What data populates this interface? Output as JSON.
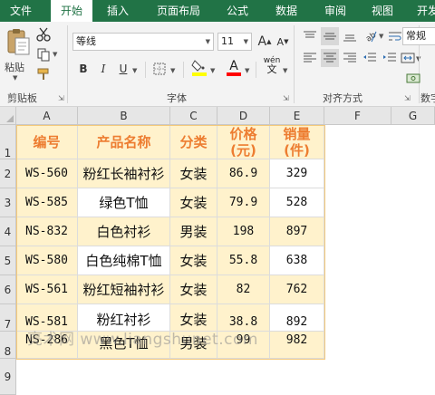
{
  "ribbon_tabs": [
    "文件",
    "开始",
    "插入",
    "页面布局",
    "公式",
    "数据",
    "审阅",
    "视图",
    "开发"
  ],
  "active_tab": "开始",
  "clipboard": {
    "paste_label": "粘贴",
    "group_label": "剪贴板"
  },
  "font": {
    "name": "等线",
    "size": "11",
    "group_label": "字体",
    "bold": "B",
    "italic": "I",
    "underline": "U",
    "grow": "A",
    "shrink": "A",
    "phonetic": "wén",
    "font_color_letter": "A"
  },
  "alignment": {
    "group_label": "对齐方式"
  },
  "number": {
    "format": "常规",
    "group_label": "数字"
  },
  "colors": {
    "ribbon_green": "#217346",
    "header_orange": "#ed7d31",
    "fill_yellow": "#fff2cc",
    "font_color_red": "#ff0000",
    "highlight_yellow": "#ffff00"
  },
  "sheet": {
    "column_headers": [
      "A",
      "B",
      "C",
      "D",
      "E",
      "F",
      "G"
    ],
    "row_headers": [
      "1",
      "2",
      "3",
      "4",
      "5",
      "6",
      "7",
      "8",
      "9"
    ],
    "header_row": [
      "编号",
      "产品名称",
      "分类",
      "价格\n(元)",
      "销量\n(件)"
    ],
    "rows": [
      [
        "WS-560",
        "粉红长袖衬衫",
        "女装",
        "86.9",
        "329"
      ],
      [
        "WS-585",
        "绿色T恤",
        "女装",
        "79.9",
        "528"
      ],
      [
        "NS-832",
        "白色衬衫",
        "男装",
        "198",
        "897"
      ],
      [
        "WS-580",
        "白色纯棉T恤",
        "女装",
        "55.8",
        "638"
      ],
      [
        "WS-561",
        "粉红短袖衬衫",
        "女装",
        "82",
        "762"
      ],
      [
        "WS-581",
        "粉红衬衫",
        "女装",
        "38.8",
        "892"
      ],
      [
        "NS-286",
        "黑色T恤",
        "男装",
        "99",
        "982"
      ]
    ]
  },
  "watermark": "亮术网 www.liangshunet.com"
}
